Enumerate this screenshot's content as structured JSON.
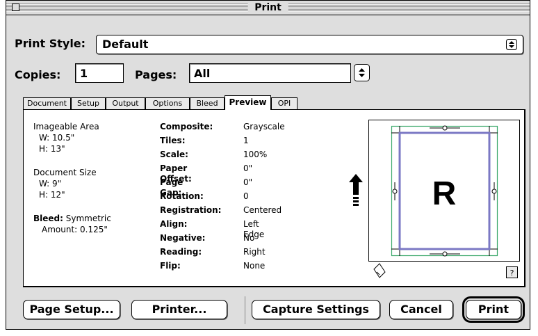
{
  "window": {
    "title": "Print"
  },
  "print_style": {
    "label": "Print Style:",
    "value": "Default"
  },
  "copies": {
    "label": "Copies:",
    "value": "1"
  },
  "pages": {
    "label": "Pages:",
    "value": "All"
  },
  "tabs": [
    "Document",
    "Setup",
    "Output",
    "Options",
    "Bleed",
    "Preview",
    "OPI"
  ],
  "active_tab": "Preview",
  "imageable_area": {
    "title": "Imageable Area",
    "w": "W: 10.5\"",
    "h": "H: 13\""
  },
  "document_size": {
    "title": "Document Size",
    "w": "W: 9\"",
    "h": "H: 12\""
  },
  "bleed": {
    "label": "Bleed:",
    "value": "Symmetric",
    "amount": "Amount: 0.125\""
  },
  "settings": [
    {
      "key": "Composite:",
      "value": "Grayscale"
    },
    {
      "key": "Tiles:",
      "value": "1"
    },
    {
      "key": "Scale:",
      "value": "100%"
    },
    {
      "key": "Paper Offset:",
      "value": "0\""
    },
    {
      "key": "Page Gap:",
      "value": "0\""
    },
    {
      "key": "Rotation:",
      "value": "0"
    },
    {
      "key": "Registration:",
      "value": "Centered"
    },
    {
      "key": "Align:",
      "value": "Left Edge"
    },
    {
      "key": "Negative:",
      "value": "No"
    },
    {
      "key": "Reading:",
      "value": "Right"
    },
    {
      "key": "Flip:",
      "value": "None"
    }
  ],
  "preview": {
    "letter": "R",
    "help": "?"
  },
  "buttons": {
    "page_setup": "Page Setup...",
    "printer": "Printer...",
    "capture": "Capture Settings",
    "cancel": "Cancel",
    "print": "Print"
  },
  "colors": {
    "page_border": "#7b78c4",
    "imageable_border": "#3aa86a"
  }
}
